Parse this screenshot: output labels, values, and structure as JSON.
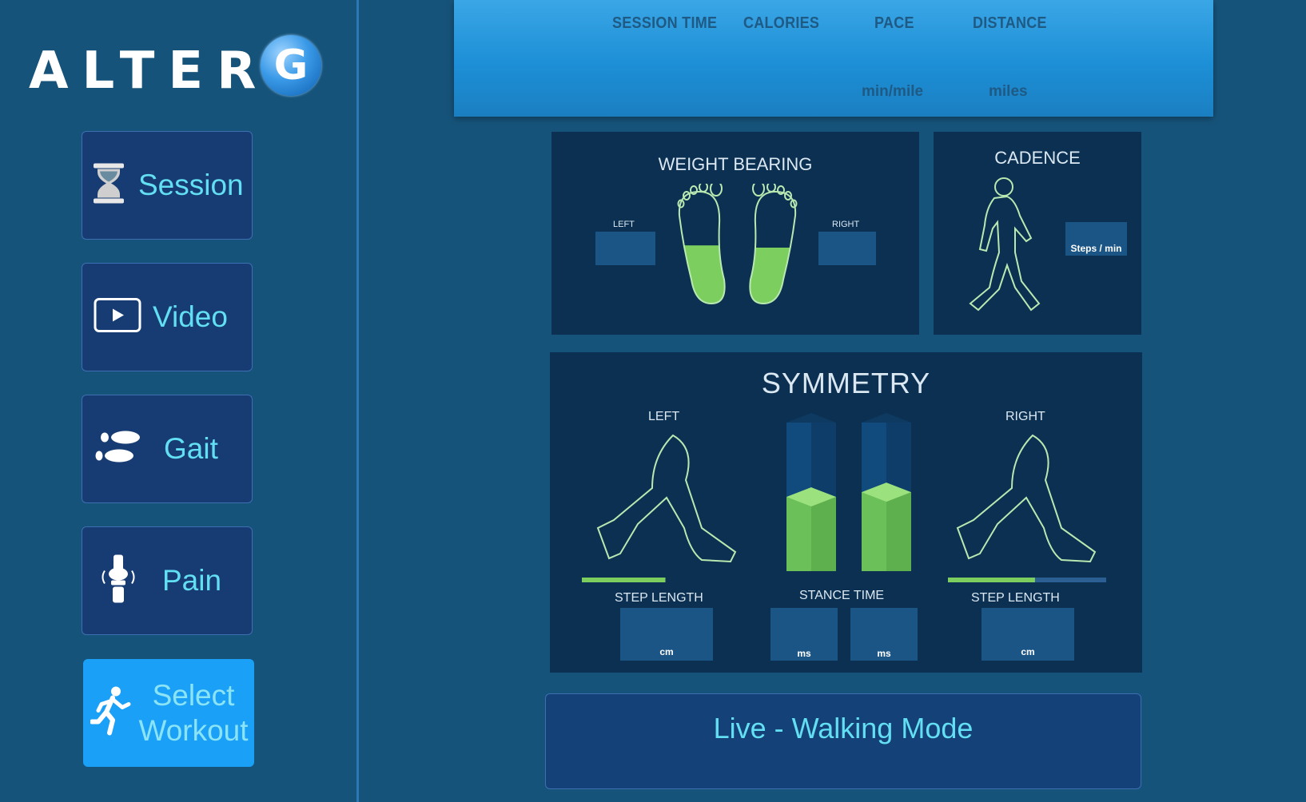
{
  "logo": {
    "text": "ALTER",
    "letter": "G"
  },
  "nav": [
    {
      "label": "Session",
      "icon": "hourglass-icon"
    },
    {
      "label": "Video",
      "icon": "play-icon"
    },
    {
      "label": "Gait",
      "icon": "footprints-icon"
    },
    {
      "label": "Pain",
      "icon": "knee-joint-icon"
    }
  ],
  "select_workout": {
    "line1": "Select",
    "line2": "Workout",
    "icon": "running-person-icon"
  },
  "stats": {
    "session_time": "SESSION TIME",
    "calories": "CALORIES",
    "pace": "PACE",
    "distance": "DISTANCE",
    "pace_unit": "min/mile",
    "distance_unit": "miles"
  },
  "weight_bearing": {
    "title": "WEIGHT BEARING",
    "left_label": "LEFT",
    "right_label": "RIGHT",
    "left_fill": 0.52,
    "right_fill": 0.5
  },
  "cadence": {
    "title": "CADENCE",
    "unit": "Steps / min"
  },
  "symmetry": {
    "title": "SYMMETRY",
    "left_label": "LEFT",
    "right_label": "RIGHT",
    "step_length_label": "STEP LENGTH",
    "stance_time_label": "STANCE TIME",
    "left_step_unit": "cm",
    "right_step_unit": "cm",
    "stance_left_unit": "ms",
    "stance_right_unit": "ms",
    "left_stance_fill": 0.53,
    "right_stance_fill": 0.56,
    "left_step_fill": 0.55,
    "right_step_fill": 0.55
  },
  "mode": {
    "label": "Live - Walking Mode"
  },
  "colors": {
    "accent": "#62dff2",
    "green": "#7ccf5f",
    "active_button": "#1aa0f7"
  }
}
